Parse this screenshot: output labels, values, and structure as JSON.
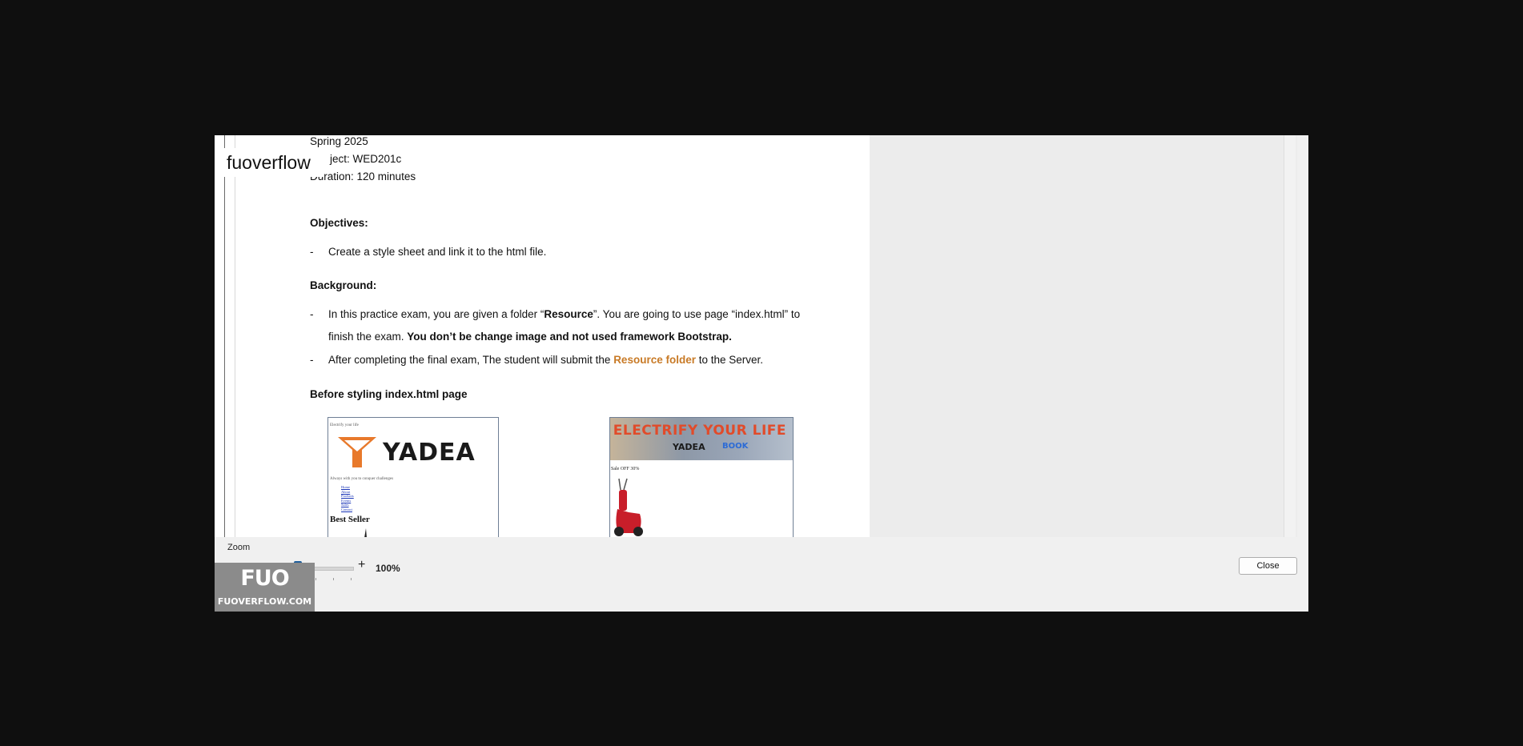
{
  "document": {
    "header_lines": [
      "Spring 2025",
      "ject: WED201c",
      "Duration: 120 minutes"
    ],
    "objectives_heading": "Objectives:",
    "objectives_items": [
      "Create a style sheet and link it to the html file."
    ],
    "background_heading": "Background:",
    "background_item1_part1": "In this practice exam, you are given a folder “",
    "background_item1_bold": "Resource",
    "background_item1_part2": "”. You are going to use page “index.html”  to",
    "background_item1_line2_part1": "finish the exam. ",
    "background_item1_line2_bold": "You don’t be change image and not used framework Bootstrap.",
    "background_item2_part1": "After completing the final exam, The student will submit the ",
    "background_item2_orange": "Resource folder",
    "background_item2_part2": " to the Server.",
    "before_heading": "Before styling index.html page",
    "dash": "-"
  },
  "screenshot_left": {
    "top_text": "Electrify your life",
    "logo_text": "YADEA",
    "tagline": "Always with you to conquer challenges",
    "links": [
      "Home",
      "About",
      "Products",
      "Events",
      "Sales",
      "Contact"
    ],
    "best_seller": "Best Seller"
  },
  "screenshot_right": {
    "banner_title": "ELECTRIFY YOUR LIFE",
    "banner_brand": "YADEA",
    "banner_brand2": "BOOK",
    "sale_text": "Sale OFF 30%"
  },
  "overlay_label": "fuoverflow",
  "zoom": {
    "label": "Zoom",
    "minus": "-",
    "plus": "+",
    "percent": "100%",
    "value_percent": 100
  },
  "close_button": "Close",
  "watermark": {
    "logo": "FUO",
    "text": "FUOVERFLOW.COM"
  },
  "colors": {
    "accent_orange": "#c87a26",
    "slider_thumb": "#1f5f9c",
    "backdrop": "#0f0f0f"
  }
}
